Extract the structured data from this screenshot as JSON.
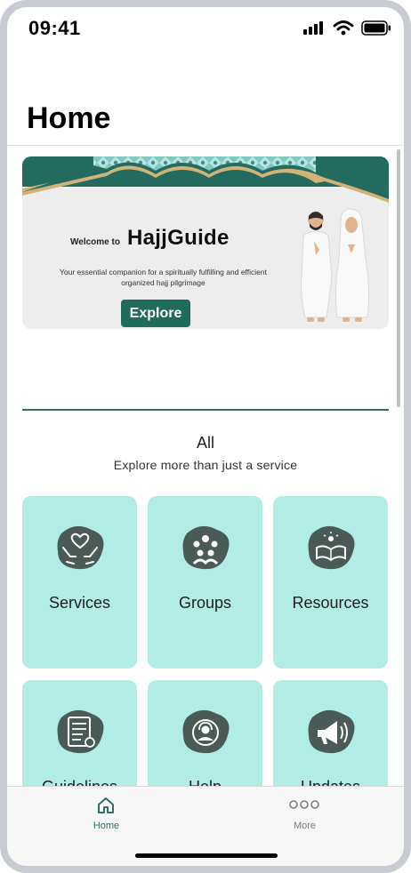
{
  "status_bar": {
    "time": "09:41"
  },
  "header": {
    "title": "Home"
  },
  "banner": {
    "welcome_text": "Welcome to",
    "brand": "HajjGuide",
    "tagline": "Your essential companion for a spiritually fulfilling and efficient organized hajj pilgrimage",
    "button_label": "Explore"
  },
  "section": {
    "title": "All",
    "subtitle": "Explore more than just a service"
  },
  "categories": [
    {
      "label": "Services",
      "icon": "heart-hands-icon"
    },
    {
      "label": "Groups",
      "icon": "people-group-icon"
    },
    {
      "label": "Resources",
      "icon": "open-book-icon"
    },
    {
      "label": "Guidelines",
      "icon": "checklist-icon"
    },
    {
      "label": "Help",
      "icon": "support-agent-icon"
    },
    {
      "label": "Updates",
      "icon": "megaphone-icon"
    }
  ],
  "tab_bar": {
    "tabs": [
      {
        "label": "Home",
        "icon": "home-icon",
        "active": true
      },
      {
        "label": "More",
        "icon": "more-dots-icon",
        "active": false
      }
    ],
    "active_color": "#2f6f66",
    "inactive_color": "#7a7a7a"
  },
  "colors": {
    "tile_bg": "#b2ede5",
    "blob": "#4a5b57",
    "accent": "#1f6b5c"
  }
}
